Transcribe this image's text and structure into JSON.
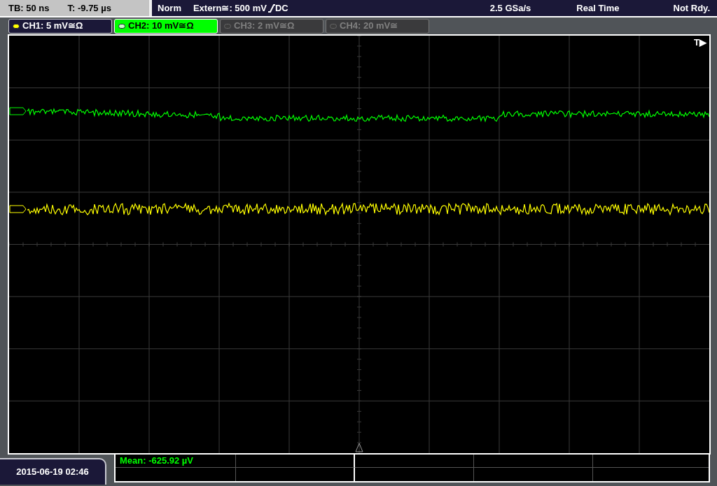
{
  "top_bar": {
    "timebase": "TB: 50 ns",
    "trigger_time": "T: -9.75 µs",
    "mode": "Norm",
    "trigger_source": "Extern≅: 500 mV",
    "coupling": "DC",
    "sample_rate": "2.5 GSa/s",
    "acquisition": "Real Time",
    "status": "Not Rdy."
  },
  "channels": [
    {
      "label": "CH1: 5 mV≅Ω",
      "selected": false,
      "on": true,
      "color": "#ffff00"
    },
    {
      "label": "CH2: 10 mV≅Ω",
      "selected": true,
      "on": true,
      "color": "#c8ffc8"
    },
    {
      "label": "CH3: 2 mV≅Ω",
      "selected": false,
      "on": false,
      "color": "#3c3c3c"
    },
    {
      "label": "CH4: 20 mV≅",
      "selected": false,
      "on": false,
      "color": "#3c3c3c"
    }
  ],
  "display": {
    "trigger_marker": "T▶",
    "traces": [
      {
        "color": "#00ff00"
      },
      {
        "color": "#ffff00"
      }
    ]
  },
  "measurement": "Mean: -625.92 µV",
  "timestamp": "2015-06-19 02:46"
}
